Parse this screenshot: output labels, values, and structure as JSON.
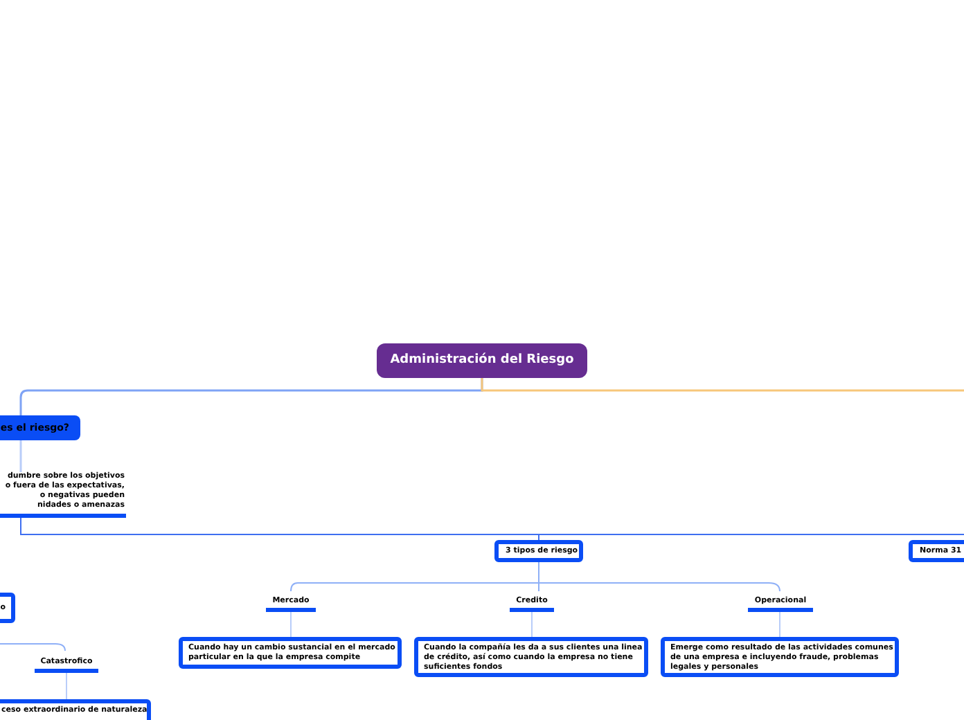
{
  "mind_map": {
    "nodes": [
      {
        "kind": "root",
        "text": "Administración del Riesgo"
      },
      {
        "kind": "topic",
        "text": "es el riesgo?"
      },
      {
        "kind": "note",
        "lines": [
          "dumbre sobre los objetivos",
          "o fuera de las expectativas,",
          "o negativas pueden",
          "nidades o amenazas"
        ]
      },
      {
        "kind": "subtopic",
        "text": "3 tipos de riesgo"
      },
      {
        "kind": "subtopic",
        "text": "Norma 31"
      },
      {
        "kind": "subtopic",
        "text": "o"
      },
      {
        "kind": "label",
        "text": "Catastrofico"
      },
      {
        "kind": "box",
        "lines": [
          "ceso extraordinario de naturaleza"
        ]
      },
      {
        "kind": "label",
        "text": "Mercado"
      },
      {
        "kind": "label",
        "text": "Credito"
      },
      {
        "kind": "label",
        "text": "Operacional"
      },
      {
        "kind": "box",
        "lines": [
          "Cuando hay un cambio sustancial en el mercado",
          "particular en la que la empresa compite"
        ]
      },
      {
        "kind": "box",
        "lines": [
          "Cuando la compañía les da a sus clientes una linea",
          "de crédito, así como cuando la empresa no tiene",
          "suficientes fondos"
        ]
      },
      {
        "kind": "box",
        "lines": [
          "Emerge como resultado de las actividades comunes",
          "de una empresa e incluyendo fraude, problemas",
          "legales y personales"
        ]
      }
    ]
  }
}
